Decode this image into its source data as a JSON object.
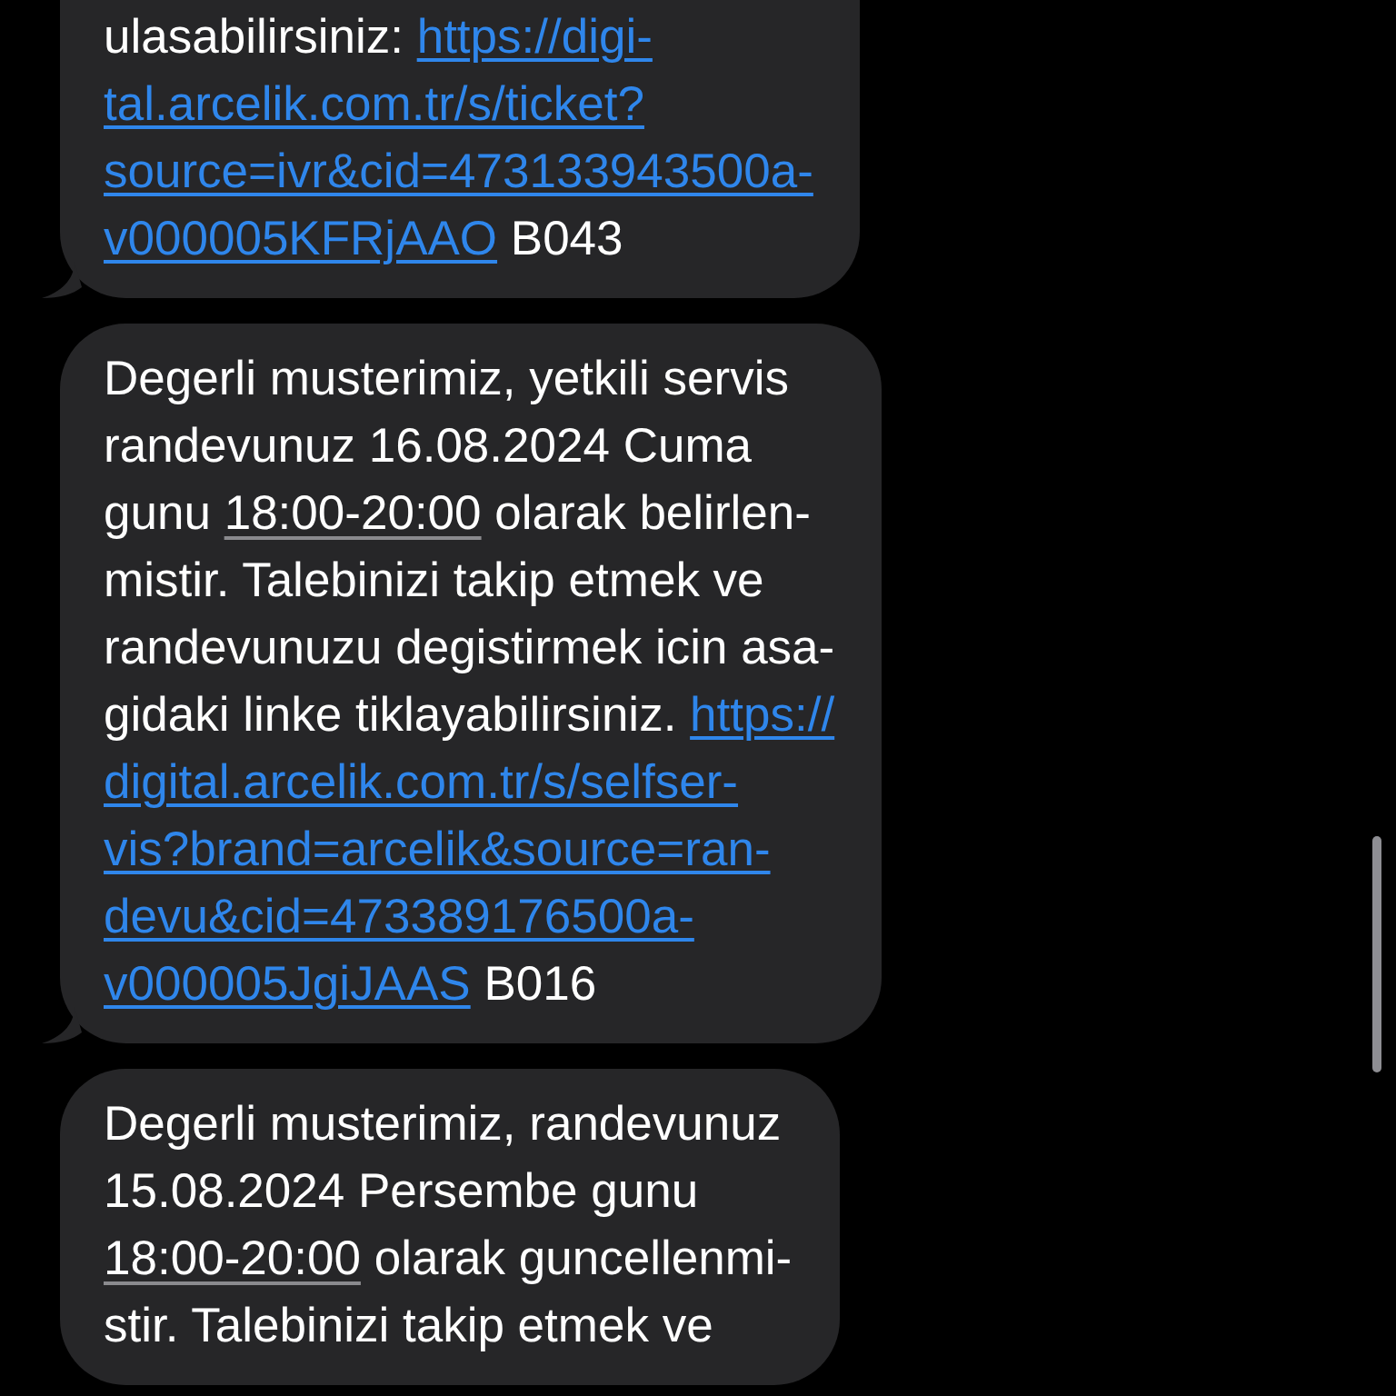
{
  "messages": [
    {
      "lines": [
        [
          {
            "kind": "text",
            "text": "ulasabilirsiniz: "
          },
          {
            "kind": "link",
            "text": "https://digi-"
          }
        ],
        [
          {
            "kind": "link",
            "text": "tal.arcelik.com.tr/s/ticket?"
          }
        ],
        [
          {
            "kind": "link",
            "text": "source=ivr&cid=473133943500a-"
          }
        ],
        [
          {
            "kind": "link",
            "text": "v000005KFRjAAO"
          },
          {
            "kind": "text",
            "text": " B043"
          }
        ]
      ]
    },
    {
      "lines": [
        [
          {
            "kind": "text",
            "text": "Degerli musterimiz, yetkili servis"
          }
        ],
        [
          {
            "kind": "text",
            "text": "randevunuz 16.08.2024 Cuma"
          }
        ],
        [
          {
            "kind": "text",
            "text": "gunu "
          },
          {
            "kind": "time",
            "text": "18:00-20:00"
          },
          {
            "kind": "text",
            "text": " olarak belirlen-"
          }
        ],
        [
          {
            "kind": "text",
            "text": "mistir. Talebinizi takip etmek ve"
          }
        ],
        [
          {
            "kind": "text",
            "text": "randevunuzu degistirmek icin asa-"
          }
        ],
        [
          {
            "kind": "text",
            "text": "gidaki linke tiklayabilirsiniz. "
          },
          {
            "kind": "link",
            "text": "https://"
          }
        ],
        [
          {
            "kind": "link",
            "text": "digital.arcelik.com.tr/s/selfser-"
          }
        ],
        [
          {
            "kind": "link",
            "text": "vis?brand=arcelik&source=ran-"
          }
        ],
        [
          {
            "kind": "link",
            "text": "devu&cid=473389176500a-"
          }
        ],
        [
          {
            "kind": "link",
            "text": "v000005JgiJAAS"
          },
          {
            "kind": "text",
            "text": " B016"
          }
        ]
      ]
    },
    {
      "lines": [
        [
          {
            "kind": "text",
            "text": "Degerli musterimiz, randevunuz"
          }
        ],
        [
          {
            "kind": "text",
            "text": "15.08.2024 Persembe gunu"
          }
        ],
        [
          {
            "kind": "time",
            "text": "18:00-20:00"
          },
          {
            "kind": "text",
            "text": " olarak guncellenmi-"
          }
        ],
        [
          {
            "kind": "text",
            "text": "stir. Talebinizi takip etmek ve"
          }
        ]
      ]
    }
  ]
}
